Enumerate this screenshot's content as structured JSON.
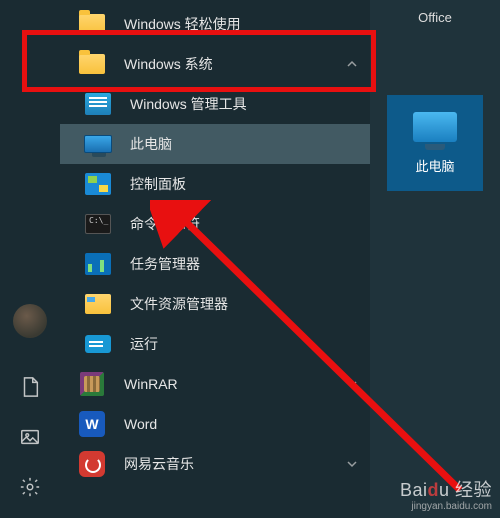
{
  "right_panel": {
    "top_label": "Office",
    "tile_caption": "此电脑"
  },
  "menu": {
    "items": [
      {
        "label": "Windows 轻松使用",
        "icon": "folder"
      },
      {
        "label": "Windows 系统",
        "icon": "folder",
        "expanded": true
      },
      {
        "label": "Windows 管理工具",
        "icon": "mgmt"
      },
      {
        "label": "此电脑",
        "icon": "pc",
        "selected": true
      },
      {
        "label": "控制面板",
        "icon": "cp"
      },
      {
        "label": "命令提示符",
        "icon": "cmd"
      },
      {
        "label": "任务管理器",
        "icon": "task"
      },
      {
        "label": "文件资源管理器",
        "icon": "explorer"
      },
      {
        "label": "运行",
        "icon": "run"
      },
      {
        "label": "WinRAR",
        "icon": "winrar",
        "chevron": true
      },
      {
        "label": "Word",
        "icon": "word"
      },
      {
        "label": "网易云音乐",
        "icon": "netease",
        "chevron": true
      }
    ]
  },
  "word_glyph": "W",
  "cmd_glyph": "C:\\_",
  "watermark": {
    "brand_prefix": "Bai",
    "brand_mid": "d",
    "brand_suffix": "u",
    "brand_cn": "经验",
    "sub": "jingyan.baidu.com"
  }
}
